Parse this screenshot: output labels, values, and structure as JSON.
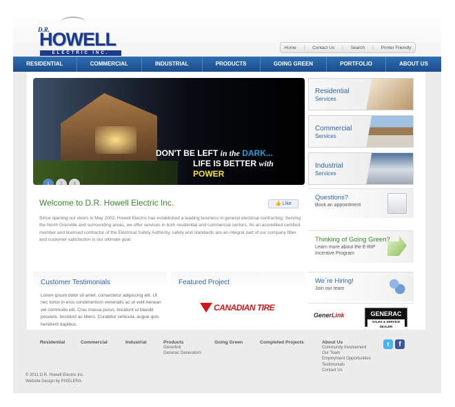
{
  "logo": {
    "prefix": "D.R.",
    "name": "HOWELL",
    "sub": "ELECTRIC INC."
  },
  "utility": [
    "Home",
    "Contact Us",
    "Search",
    "Printer Friendly"
  ],
  "nav": [
    "RESIDENTIAL",
    "COMMERCIAL",
    "INDUSTRIAL",
    "PRODUCTS",
    "GOING GREEN",
    "PORTFOLIO",
    "ABOUT US"
  ],
  "hero": {
    "line1_a": "DON'T BE LEFT",
    "line1_b": "in the",
    "line1_c": "DARK...",
    "line2_a": "LIFE IS BETTER",
    "line2_b": "with",
    "line2_c": "POWER",
    "slides": [
      "1",
      "2",
      "3"
    ],
    "active_slide": 1
  },
  "services": [
    {
      "title": "Residential",
      "sub": "Services"
    },
    {
      "title": "Commercial",
      "sub": "Services"
    },
    {
      "title": "Industrial",
      "sub": "Services"
    }
  ],
  "welcome": {
    "title": "Welcome to D.R. Howell Electric Inc.",
    "like": "Like",
    "body": "Since opening our doors in May 2002, Howell Electric has established a leading business in general electrical contracting. Serving the North Grenville and surrounding areas, we offer services in both residential and commercial sectors. As an accredited certified member and licensed contractor of the Electrical Safety Authority, safety and standards are an integral part of our company fiber and customer satisfaction is our ultimate goal."
  },
  "testimonials": {
    "title": "Customer Testimonials",
    "body": "Lorem ipsum dolor sit amet, consectetur adipiscing elit. Ut nec tortor in eros condimentum venenatis ac ut velit Aenean vel commodo elit. Cras massa purus, tincidunt ut blandit posuere, tincidunt ac libero. Curabitur vehicula, augue quis hendrerit dapibus."
  },
  "featured": {
    "title": "Featured Project",
    "logo_text": "CANADIAN TIRE"
  },
  "side": {
    "questions": {
      "title": "Questions?",
      "sub": "Book an appointment"
    },
    "green": {
      "title": "Thinking of Going Green?",
      "sub": "Learn more about the E-RIP Incentive Program"
    },
    "hiring": {
      "title": "We`re Hiring!",
      "sub": "Join our team"
    }
  },
  "dealers": {
    "generlink_a": "Gener",
    "generlink_b": "Link",
    "generac": "GENERAC",
    "generac_sub": "SALES & SERVICE DEALER"
  },
  "footer": {
    "residential": "Residential",
    "commercial": "Commercial",
    "industrial": "Industrial",
    "products": "Products",
    "products_sub": [
      "Generlink",
      "Generac Generators"
    ],
    "going_green": "Going Green",
    "completed": "Completed Projects",
    "about": "About Us",
    "about_sub": [
      "Community Involvement",
      "Our Team",
      "Employment Opportunities",
      "Testimonials",
      "Contact Us"
    ],
    "copyright": "© 2011 D.R. Howell Electric Inc.",
    "design": "Website Design by PIXELERA"
  }
}
